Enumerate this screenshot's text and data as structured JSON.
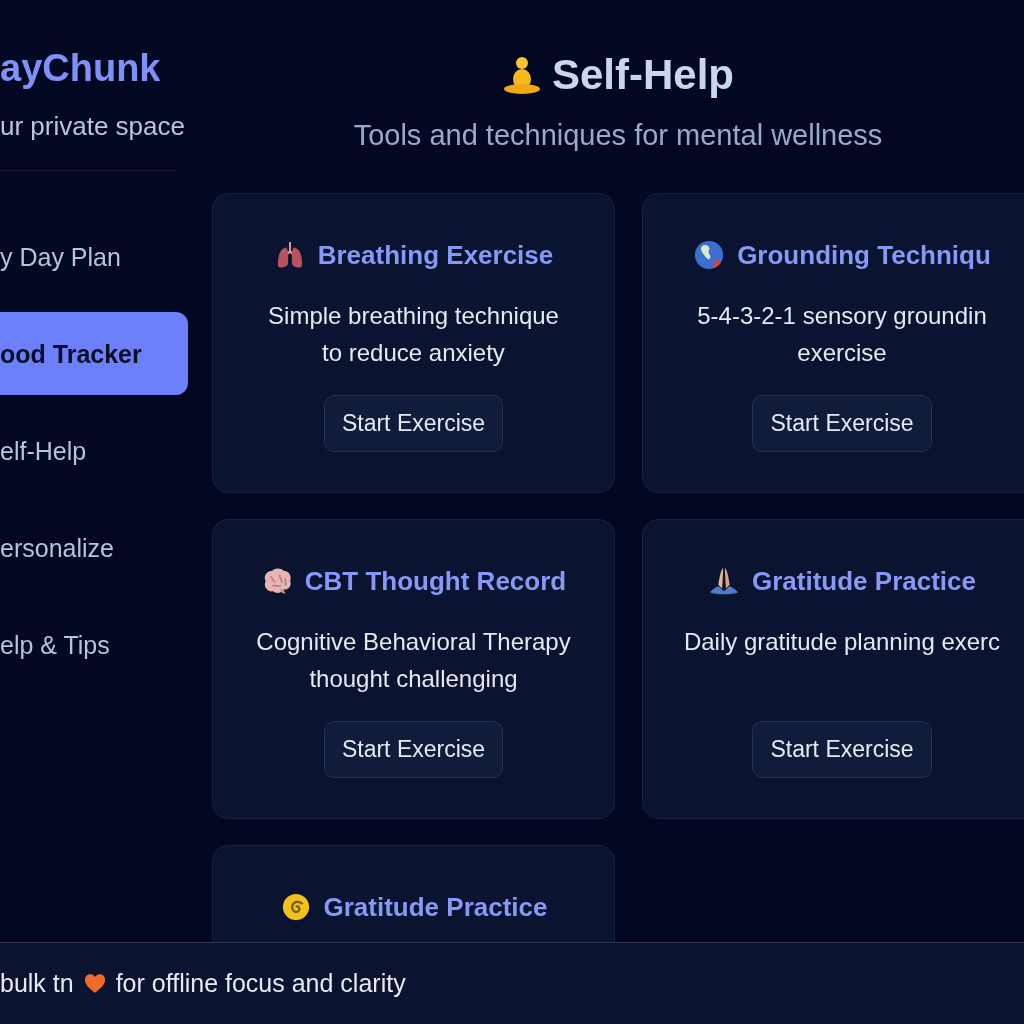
{
  "sidebar": {
    "app_name": "ayChunk",
    "tagline": "ur private space",
    "items": [
      {
        "label": "y Day Plan",
        "selected": false
      },
      {
        "label": "ood Tracker",
        "selected": true
      },
      {
        "label": "elf-Help",
        "selected": false
      },
      {
        "label": "ersonalize",
        "selected": false
      },
      {
        "label": "elp & Tips",
        "selected": false
      }
    ]
  },
  "header": {
    "title": "Self-Help",
    "subtitle": "Tools and techniques for mental wellness"
  },
  "cards": [
    {
      "title": "Breathing Exercise",
      "description": "Simple breathing technique\nto reduce anxiety",
      "button": "Start Exercise"
    },
    {
      "title": "Grounding Techniqu",
      "description": "5-4-3-2-1 sensory groundin\nexercise",
      "button": "Start Exercise"
    },
    {
      "title": "CBT Thought Record",
      "description": "Cognitive Behavioral Therapy\nthought challenging",
      "button": "Start Exercise"
    },
    {
      "title": "Gratitude Practice",
      "description": "Daily gratitude planning exerc",
      "button": "Start Exercise"
    },
    {
      "title": "Gratitude Practice"
    }
  ],
  "footer": {
    "lead": "bulk tn",
    "tail": "for offline focus and clarity"
  }
}
